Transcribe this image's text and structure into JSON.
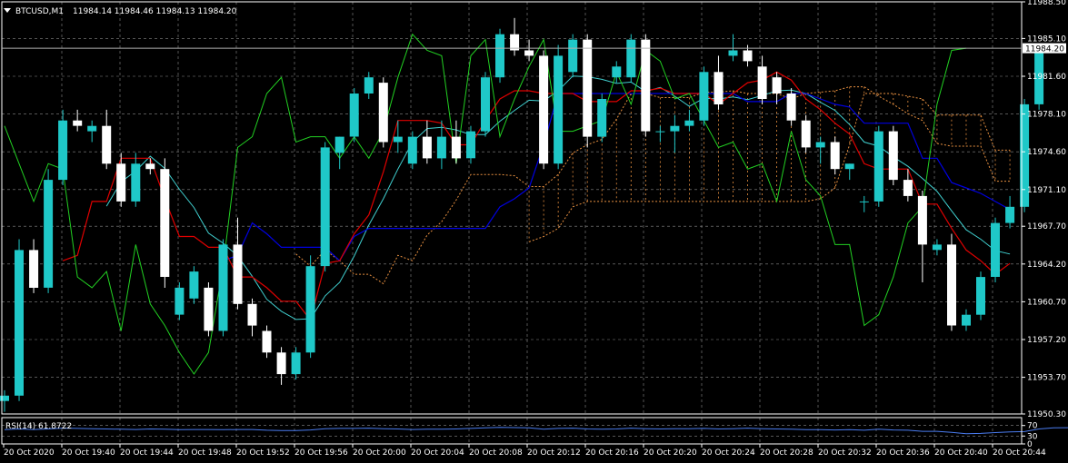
{
  "header": {
    "symbol": "BTCUSD,M1",
    "ohlc": "11984.14 11984.46 11984.13 11984.20"
  },
  "rsi_header": "RSI(14) 61.8722",
  "colors": {
    "background": "#000000",
    "grid": "#8a8a8a",
    "bull": "#1fc8c8",
    "bear": "#ffffff",
    "tenkan": "#e00000",
    "kijun": "#0000e0",
    "chikou": "#22d022",
    "span": "#e89040",
    "ma": "#40d0d0",
    "rsi": "#4a7cf0"
  },
  "chart_data": [
    {
      "type": "candlestick",
      "symbol": "BTCUSD",
      "timeframe": "M1",
      "price_axis_ticks": [
        "11988.50",
        "11985.10",
        "11981.60",
        "11978.10",
        "11974.60",
        "11971.10",
        "11967.70",
        "11964.20",
        "11960.70",
        "11957.20",
        "11953.70",
        "11950.30"
      ],
      "ylim": [
        11950.3,
        11988.5
      ],
      "current_price_label": "11984.20",
      "current_price": 11984.2,
      "time_axis_labels": [
        "20 Oct 2020",
        "20 Oct 19:40",
        "20 Oct 19:44",
        "20 Oct 19:48",
        "20 Oct 19:52",
        "20 Oct 19:56",
        "20 Oct 20:00",
        "20 Oct 20:04",
        "20 Oct 20:08",
        "20 Oct 20:12",
        "20 Oct 20:16",
        "20 Oct 20:20",
        "20 Oct 20:24",
        "20 Oct 20:28",
        "20 Oct 20:32",
        "20 Oct 20:36",
        "20 Oct 20:40",
        "20 Oct 20:44"
      ],
      "grid": true,
      "candles": [
        {
          "o": 11951.5,
          "h": 11952.5,
          "l": 11950.5,
          "c": 11952.0
        },
        {
          "o": 11952.0,
          "h": 11966.5,
          "l": 11951.5,
          "c": 11965.5
        },
        {
          "o": 11965.5,
          "h": 11966.5,
          "l": 11961.5,
          "c": 11962.0
        },
        {
          "o": 11962.0,
          "h": 11973.0,
          "l": 11961.5,
          "c": 11972.0
        },
        {
          "o": 11972.0,
          "h": 11978.5,
          "l": 11971.5,
          "c": 11977.5
        },
        {
          "o": 11977.5,
          "h": 11978.5,
          "l": 11976.5,
          "c": 11977.0
        },
        {
          "o": 11976.5,
          "h": 11977.5,
          "l": 11975.5,
          "c": 11977.0
        },
        {
          "o": 11977.0,
          "h": 11978.5,
          "l": 11973.0,
          "c": 11973.5
        },
        {
          "o": 11973.5,
          "h": 11974.5,
          "l": 11969.5,
          "c": 11970.0
        },
        {
          "o": 11970.0,
          "h": 11974.5,
          "l": 11969.5,
          "c": 11973.5
        },
        {
          "o": 11973.5,
          "h": 11974.0,
          "l": 11972.5,
          "c": 11973.0
        },
        {
          "o": 11973.0,
          "h": 11974.0,
          "l": 11962.0,
          "c": 11963.0
        },
        {
          "o": 11959.5,
          "h": 11962.5,
          "l": 11959.0,
          "c": 11962.0
        },
        {
          "o": 11961.0,
          "h": 11964.0,
          "l": 11960.5,
          "c": 11963.5
        },
        {
          "o": 11962.0,
          "h": 11962.5,
          "l": 11957.5,
          "c": 11958.0
        },
        {
          "o": 11958.0,
          "h": 11966.5,
          "l": 11957.5,
          "c": 11966.0
        },
        {
          "o": 11966.0,
          "h": 11968.5,
          "l": 11960.0,
          "c": 11960.5
        },
        {
          "o": 11960.5,
          "h": 11961.0,
          "l": 11957.5,
          "c": 11958.5
        },
        {
          "o": 11958.0,
          "h": 11958.5,
          "l": 11955.5,
          "c": 11956.0
        },
        {
          "o": 11956.0,
          "h": 11956.5,
          "l": 11953.0,
          "c": 11954.0
        },
        {
          "o": 11954.0,
          "h": 11956.5,
          "l": 11953.5,
          "c": 11956.0
        },
        {
          "o": 11956.0,
          "h": 11965.0,
          "l": 11955.5,
          "c": 11964.0
        },
        {
          "o": 11964.0,
          "h": 11975.5,
          "l": 11963.5,
          "c": 11975.0
        },
        {
          "o": 11974.5,
          "h": 11976.0,
          "l": 11973.0,
          "c": 11976.0
        },
        {
          "o": 11976.0,
          "h": 11980.5,
          "l": 11975.5,
          "c": 11980.0
        },
        {
          "o": 11980.0,
          "h": 11982.0,
          "l": 11979.5,
          "c": 11981.5
        },
        {
          "o": 11981.0,
          "h": 11981.5,
          "l": 11975.0,
          "c": 11975.5
        },
        {
          "o": 11975.5,
          "h": 11977.5,
          "l": 11974.5,
          "c": 11976.0
        },
        {
          "o": 11973.5,
          "h": 11976.5,
          "l": 11973.0,
          "c": 11976.0
        },
        {
          "o": 11976.0,
          "h": 11977.5,
          "l": 11973.5,
          "c": 11974.0
        },
        {
          "o": 11974.0,
          "h": 11977.5,
          "l": 11973.0,
          "c": 11976.0
        },
        {
          "o": 11976.0,
          "h": 11977.5,
          "l": 11973.5,
          "c": 11974.0
        },
        {
          "o": 11974.0,
          "h": 11977.0,
          "l": 11973.5,
          "c": 11976.5
        },
        {
          "o": 11976.5,
          "h": 11982.0,
          "l": 11976.0,
          "c": 11981.5
        },
        {
          "o": 11981.5,
          "h": 11986.0,
          "l": 11981.0,
          "c": 11985.5
        },
        {
          "o": 11985.5,
          "h": 11987.0,
          "l": 11983.5,
          "c": 11984.0
        },
        {
          "o": 11984.0,
          "h": 11985.0,
          "l": 11983.0,
          "c": 11983.5
        },
        {
          "o": 11983.5,
          "h": 11984.0,
          "l": 11973.0,
          "c": 11973.5
        },
        {
          "o": 11973.5,
          "h": 11984.5,
          "l": 11973.0,
          "c": 11983.5
        },
        {
          "o": 11982.0,
          "h": 11985.5,
          "l": 11981.5,
          "c": 11985.0
        },
        {
          "o": 11985.0,
          "h": 11985.5,
          "l": 11975.0,
          "c": 11976.0
        },
        {
          "o": 11976.0,
          "h": 11980.0,
          "l": 11975.5,
          "c": 11979.5
        },
        {
          "o": 11981.5,
          "h": 11983.0,
          "l": 11981.0,
          "c": 11982.5
        },
        {
          "o": 11981.5,
          "h": 11985.5,
          "l": 11981.0,
          "c": 11985.0
        },
        {
          "o": 11985.0,
          "h": 11985.5,
          "l": 11976.0,
          "c": 11976.5
        },
        {
          "o": 11976.5,
          "h": 11977.0,
          "l": 11975.5,
          "c": 11976.5
        },
        {
          "o": 11976.5,
          "h": 11978.0,
          "l": 11974.5,
          "c": 11977.0
        },
        {
          "o": 11977.0,
          "h": 11978.5,
          "l": 11976.5,
          "c": 11977.5
        },
        {
          "o": 11977.5,
          "h": 11982.5,
          "l": 11977.0,
          "c": 11982.0
        },
        {
          "o": 11982.0,
          "h": 11983.5,
          "l": 11978.5,
          "c": 11979.0
        },
        {
          "o": 11983.5,
          "h": 11985.5,
          "l": 11983.0,
          "c": 11984.0
        },
        {
          "o": 11984.0,
          "h": 11984.5,
          "l": 11982.5,
          "c": 11983.0
        },
        {
          "o": 11982.5,
          "h": 11983.5,
          "l": 11979.0,
          "c": 11979.5
        },
        {
          "o": 11981.5,
          "h": 11982.0,
          "l": 11979.0,
          "c": 11980.0
        },
        {
          "o": 11980.0,
          "h": 11980.5,
          "l": 11977.0,
          "c": 11977.5
        },
        {
          "o": 11977.5,
          "h": 11978.0,
          "l": 11974.5,
          "c": 11975.0
        },
        {
          "o": 11975.0,
          "h": 11976.0,
          "l": 11973.5,
          "c": 11975.5
        },
        {
          "o": 11975.5,
          "h": 11976.0,
          "l": 11972.5,
          "c": 11973.0
        },
        {
          "o": 11973.0,
          "h": 11973.5,
          "l": 11972.0,
          "c": 11973.5
        },
        {
          "o": 11970.0,
          "h": 11970.5,
          "l": 11969.0,
          "c": 11970.0
        },
        {
          "o": 11970.0,
          "h": 11977.0,
          "l": 11969.5,
          "c": 11976.5
        },
        {
          "o": 11976.5,
          "h": 11977.0,
          "l": 11971.5,
          "c": 11972.0
        },
        {
          "o": 11972.0,
          "h": 11973.0,
          "l": 11970.0,
          "c": 11970.5
        },
        {
          "o": 11970.5,
          "h": 11971.0,
          "l": 11962.5,
          "c": 11966.0
        },
        {
          "o": 11965.5,
          "h": 11966.5,
          "l": 11965.0,
          "c": 11966.0
        },
        {
          "o": 11966.0,
          "h": 11967.0,
          "l": 11958.0,
          "c": 11958.5
        },
        {
          "o": 11958.5,
          "h": 11960.0,
          "l": 11958.0,
          "c": 11959.5
        },
        {
          "o": 11959.5,
          "h": 11963.5,
          "l": 11959.0,
          "c": 11963.0
        },
        {
          "o": 11963.0,
          "h": 11968.5,
          "l": 11962.5,
          "c": 11968.0
        },
        {
          "o": 11968.0,
          "h": 11970.5,
          "l": 11967.5,
          "c": 11969.5
        },
        {
          "o": 11969.5,
          "h": 11979.5,
          "l": 11969.0,
          "c": 11979.0
        },
        {
          "o": 11979.0,
          "h": 11984.5,
          "l": 11978.5,
          "c": 11984.0
        },
        {
          "o": 11984.14,
          "h": 11984.46,
          "l": 11984.13,
          "c": 11984.2
        }
      ],
      "indicators": {
        "tenkan": [
          null,
          null,
          null,
          null,
          null,
          null,
          null,
          null,
          null,
          null,
          null,
          null,
          null,
          null,
          null,
          null,
          null,
          null,
          null,
          null,
          null,
          null,
          null,
          null,
          null,
          null,
          null,
          null,
          null,
          null,
          null,
          null,
          null,
          null,
          null,
          null,
          null,
          null,
          null,
          null,
          null,
          null,
          null,
          null,
          null,
          null,
          null,
          null,
          null,
          null,
          null,
          null,
          null,
          null,
          null,
          null,
          null,
          null,
          null,
          null,
          null,
          null,
          null,
          null,
          null,
          null,
          null,
          null,
          null,
          null,
          null,
          null,
          null
        ],
        "kijun": [],
        "chikou": [],
        "senkou_a": [],
        "senkou_b": [],
        "ma": []
      }
    },
    {
      "type": "line",
      "name": "RSI(14)",
      "current_value": 61.8722,
      "ylim": [
        0,
        100
      ],
      "levels": [
        70,
        30
      ],
      "tick_labels": [
        "70",
        "30",
        "0"
      ],
      "values": [
        54,
        57,
        55,
        57,
        60,
        59,
        58,
        57,
        56,
        55,
        57,
        56,
        54,
        55,
        55,
        54,
        55,
        55,
        52,
        51,
        51,
        53,
        58,
        59,
        59,
        60,
        58,
        57,
        55,
        56,
        56,
        57,
        59,
        61,
        63,
        62,
        61,
        56,
        59,
        60,
        57,
        56,
        57,
        60,
        58,
        57,
        58,
        58,
        59,
        57,
        58,
        60,
        58,
        57,
        56,
        54,
        54,
        53,
        54,
        52,
        56,
        53,
        52,
        48,
        48,
        44,
        39,
        40,
        43,
        46,
        47,
        57,
        61,
        61.8722
      ]
    }
  ]
}
